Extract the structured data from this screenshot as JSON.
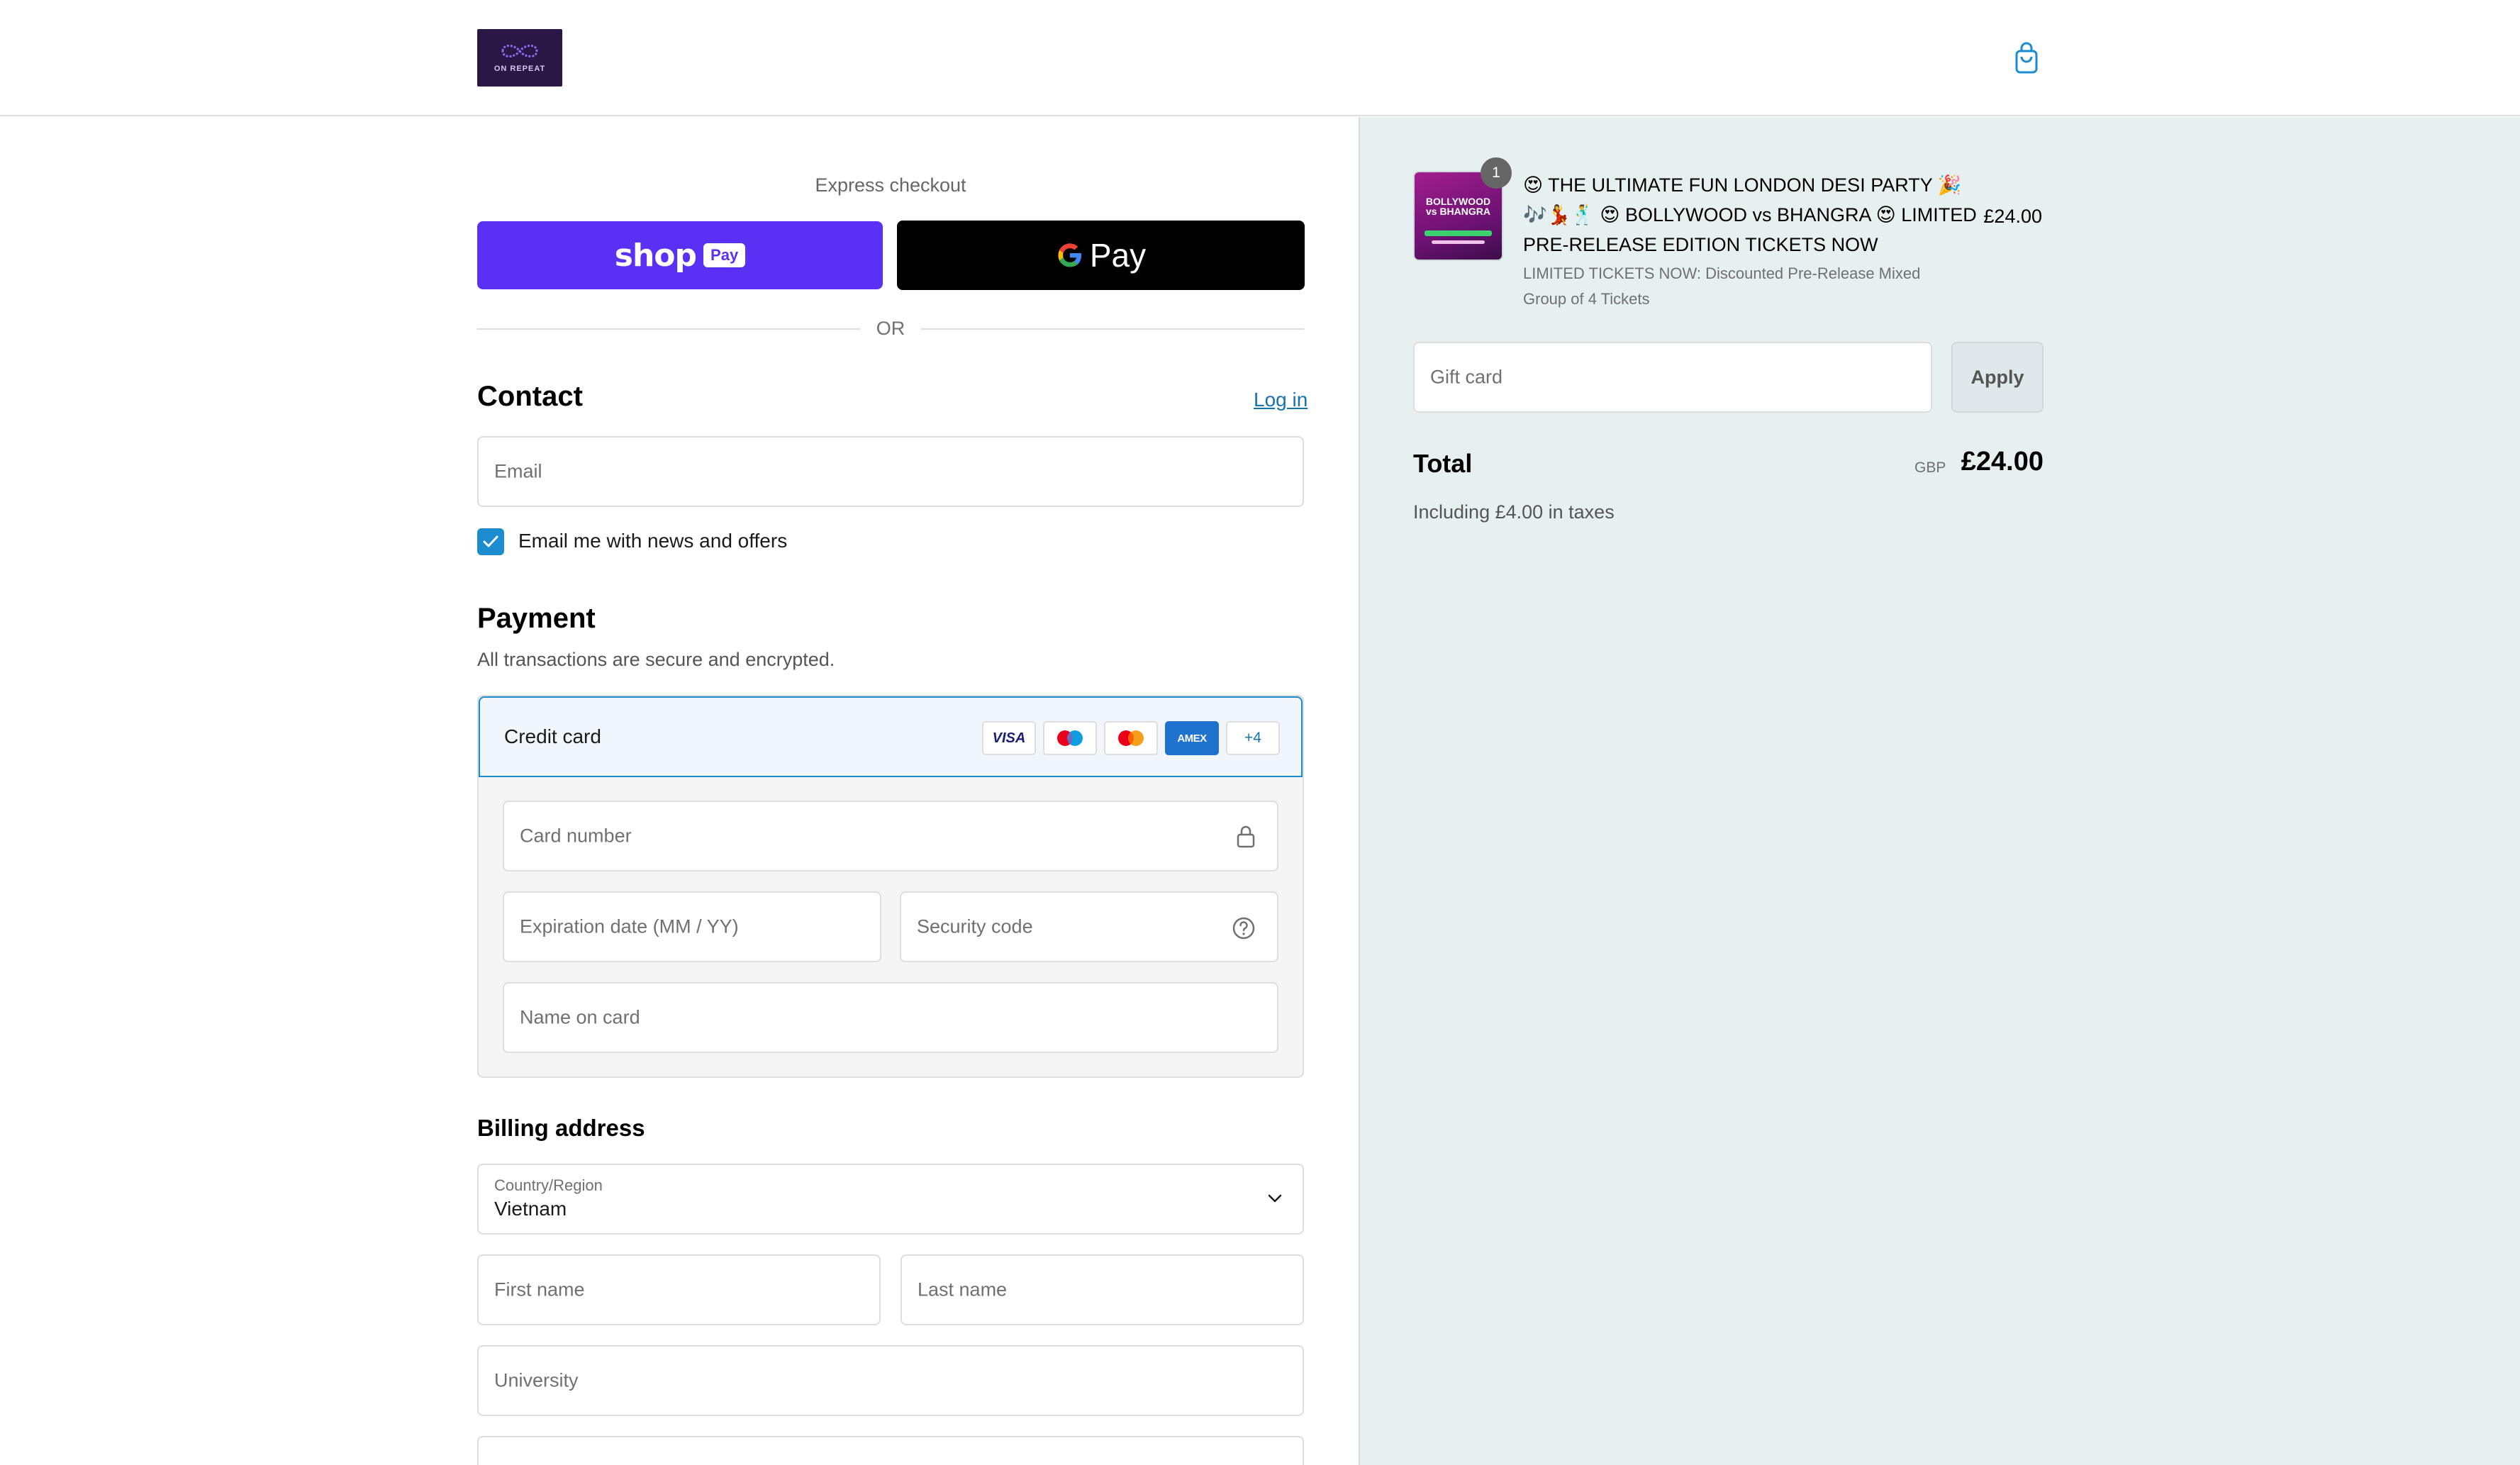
{
  "header": {
    "logo_text": "ON REPEAT",
    "cart_icon": "shopping-bag-icon"
  },
  "express": {
    "title": "Express checkout",
    "shop_pay_word": "shop",
    "shop_pay_pill": "Pay",
    "gpay_word": "Pay",
    "or_text": "OR"
  },
  "contact": {
    "title": "Contact",
    "login_label": "Log in",
    "email_placeholder": "Email",
    "newsletter_label": "Email me with news and offers",
    "newsletter_checked": true
  },
  "payment": {
    "title": "Payment",
    "subtitle": "All transactions are secure and encrypted.",
    "method_label": "Credit card",
    "badges": [
      "VISA",
      "Maestro",
      "Mastercard",
      "AMEX",
      "+4"
    ],
    "card_number_placeholder": "Card number",
    "expiry_placeholder": "Expiration date (MM / YY)",
    "security_placeholder": "Security code",
    "name_placeholder": "Name on card"
  },
  "billing": {
    "title": "Billing address",
    "country_label": "Country/Region",
    "country_value": "Vietnam",
    "first_name_placeholder": "First name",
    "last_name_placeholder": "Last name",
    "company_placeholder": "University"
  },
  "summary": {
    "quantity": "1",
    "product_title": "😍 THE ULTIMATE FUN LONDON DESI PARTY 🎉🎶💃🕺 😍 BOLLYWOOD vs BHANGRA 😍 LIMITED PRE-RELEASE EDITION TICKETS NOW",
    "product_variant": "LIMITED TICKETS NOW: Discounted Pre-Release Mixed Group of 4 Tickets",
    "product_price": "£24.00",
    "thumb_text": "BOLLYWOOD vs BHANGRA",
    "gift_card_placeholder": "Gift card",
    "apply_label": "Apply",
    "total_label": "Total",
    "currency": "GBP",
    "total_amount": "£24.00",
    "tax_note": "Including £4.00 in taxes"
  },
  "colors": {
    "accent": "#1a8ccf",
    "shop_pay": "#5a31f4",
    "link": "#1773b0",
    "summary_bg": "#e6f0f1"
  }
}
